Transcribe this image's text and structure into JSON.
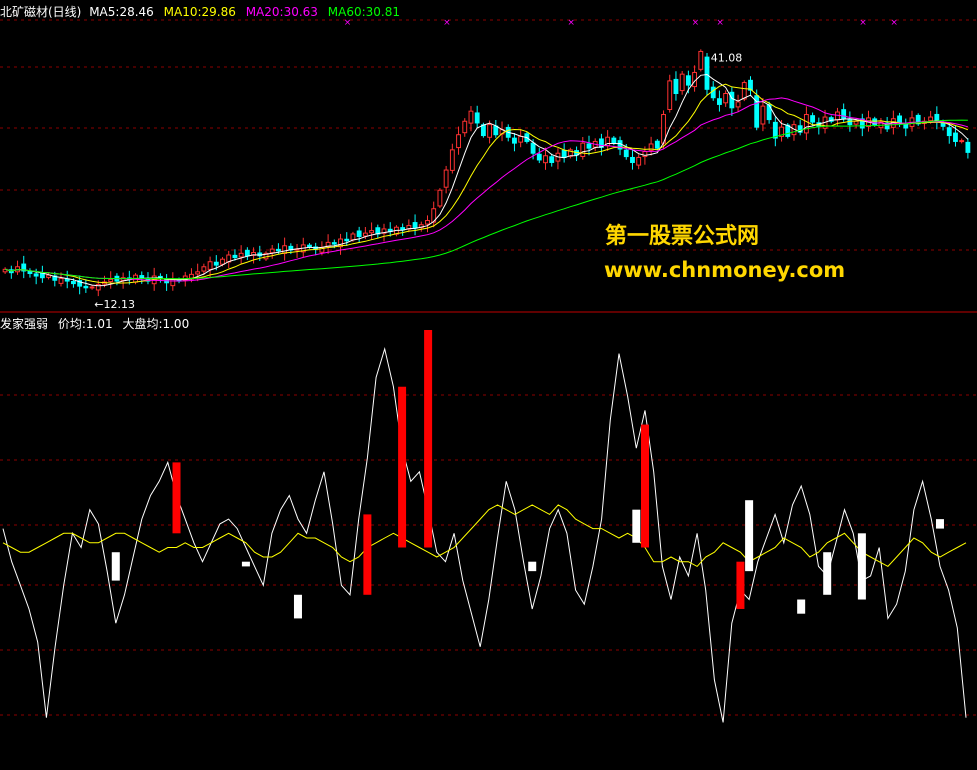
{
  "upper": {
    "stock_name": "北矿磁材(日线)",
    "legend": [
      {
        "label": "MA5:28.46",
        "color": "#ffffff"
      },
      {
        "label": "MA10:29.86",
        "color": "#ffff00"
      },
      {
        "label": "MA20:30.63",
        "color": "#ff00ff"
      },
      {
        "label": "MA60:30.81",
        "color": "#00ff00"
      }
    ],
    "high_label": "41.08",
    "low_label": "←12.13"
  },
  "lower": {
    "indicator_name": "发家强弱",
    "legend": [
      {
        "label": "价均:1.01",
        "color": "#ffffff"
      },
      {
        "label": "大盘均:1.00",
        "color": "#ffffff"
      }
    ]
  },
  "watermark": {
    "line1": "第一股票公式网",
    "line2": "www.chnmoney.com"
  },
  "colors": {
    "up": "#ff3232",
    "down": "#00ffff",
    "ma5": "#ffffff",
    "ma10": "#ffff00",
    "ma20": "#ff00ff",
    "ma60": "#00ff00",
    "grid": "#8b0000",
    "watermark": "#ffd700"
  },
  "chart_data": [
    {
      "type": "candlestick",
      "ylim": [
        10,
        44
      ],
      "close": [
        14.6,
        14.2,
        14.9,
        14.4,
        14.1,
        13.8,
        13.6,
        13.9,
        13.3,
        13.5,
        13.2,
        12.9,
        12.6,
        12.4,
        12.5,
        12.8,
        13.1,
        13.4,
        13.2,
        13.6,
        13.4,
        13.9,
        13.6,
        13.2,
        13.8,
        13.5,
        13.0,
        13.4,
        13.2,
        13.8,
        14.0,
        14.3,
        14.9,
        15.5,
        15.1,
        15.8,
        16.3,
        16.0,
        16.5,
        16.2,
        16.6,
        16.2,
        16.5,
        17.0,
        16.8,
        17.4,
        16.9,
        17.0,
        17.5,
        17.3,
        17.0,
        17.2,
        17.8,
        17.6,
        18.2,
        18.0,
        18.8,
        18.5,
        18.9,
        19.2,
        18.8,
        19.4,
        19.1,
        19.6,
        19.3,
        19.8,
        19.5,
        19.9,
        20.4,
        21.8,
        24.0,
        26.4,
        28.8,
        30.6,
        32.2,
        33.4,
        32.0,
        30.5,
        31.8,
        30.6,
        31.2,
        30.3,
        29.6,
        30.4,
        29.8,
        28.4,
        27.6,
        28.1,
        27.3,
        28.4,
        27.9,
        28.8,
        28.2,
        29.6,
        29.0,
        29.8,
        29.1,
        30.3,
        29.6,
        28.9,
        28.0,
        27.3,
        27.9,
        28.6,
        29.5,
        29.0,
        33.0,
        37.0,
        35.5,
        37.8,
        36.5,
        38.0,
        40.5,
        36.0,
        35.0,
        34.2,
        35.5,
        33.8,
        34.5,
        36.8,
        35.9,
        31.5,
        34.0,
        32.4,
        30.2,
        31.5,
        30.4,
        31.8,
        30.9,
        33.0,
        32.1,
        31.6,
        32.7,
        32.2,
        33.3,
        32.5,
        31.8,
        32.2,
        31.4,
        32.6,
        31.8,
        32.1,
        31.3,
        32.5,
        32.0,
        31.4,
        32.6,
        31.9,
        32.2,
        32.7,
        32.1,
        31.6,
        30.5,
        29.8,
        29.9,
        28.5
      ],
      "ma_order": [
        "MA5",
        "MA10",
        "MA20",
        "MA60"
      ]
    },
    {
      "type": "line+bar",
      "ylim": [
        -4.6,
        4.6
      ],
      "series": [
        {
          "name": "价均",
          "values": [
            0.4,
            -0.3,
            -0.8,
            -1.3,
            -2.0,
            -3.6,
            -2.1,
            -0.8,
            0.3,
            0.0,
            0.8,
            0.5,
            -0.5,
            -1.6,
            -1.0,
            -0.2,
            0.6,
            1.1,
            1.4,
            1.8,
            1.1,
            0.6,
            0.1,
            -0.3,
            0.1,
            0.5,
            0.6,
            0.4,
            0.0,
            -0.4,
            -0.8,
            0.3,
            0.8,
            1.1,
            0.6,
            0.3,
            1.0,
            1.6,
            0.5,
            -0.8,
            -1.0,
            0.6,
            1.9,
            3.6,
            4.2,
            3.4,
            2.1,
            1.4,
            1.6,
            0.8,
            -0.1,
            -0.3,
            0.3,
            -0.7,
            -1.4,
            -2.1,
            -1.1,
            0.2,
            1.4,
            0.8,
            -0.3,
            -1.3,
            -0.6,
            0.4,
            0.8,
            0.3,
            -0.9,
            -1.2,
            -0.4,
            0.6,
            2.7,
            4.1,
            3.2,
            2.1,
            2.9,
            1.6,
            -0.4,
            -1.1,
            -0.2,
            -0.6,
            0.3,
            -0.9,
            -2.8,
            -3.7,
            -1.6,
            -0.9,
            -1.1,
            -0.3,
            0.2,
            0.7,
            0.1,
            0.9,
            1.3,
            0.7,
            -0.4,
            -0.6,
            0.1,
            0.8,
            0.3,
            -0.7,
            -0.6,
            0.0,
            -1.5,
            -1.2,
            -0.5,
            0.8,
            1.4,
            0.6,
            -0.4,
            -0.9,
            -1.7,
            -3.6
          ],
          "color": "#ffffff"
        },
        {
          "name": "大盘均",
          "values": [
            0.1,
            0.0,
            -0.1,
            -0.1,
            0.0,
            0.1,
            0.2,
            0.3,
            0.3,
            0.2,
            0.1,
            0.1,
            0.2,
            0.3,
            0.3,
            0.2,
            0.1,
            0.0,
            -0.1,
            0.0,
            0.0,
            0.1,
            0.0,
            0.0,
            0.1,
            0.2,
            0.3,
            0.2,
            0.1,
            -0.1,
            -0.2,
            -0.2,
            -0.1,
            0.1,
            0.3,
            0.2,
            0.2,
            0.1,
            0.0,
            -0.2,
            -0.3,
            -0.2,
            0.0,
            0.1,
            0.2,
            0.3,
            0.2,
            0.1,
            0.0,
            -0.1,
            -0.2,
            -0.1,
            0.0,
            0.2,
            0.4,
            0.6,
            0.8,
            0.9,
            0.8,
            0.7,
            0.8,
            0.9,
            0.8,
            0.7,
            0.9,
            0.8,
            0.6,
            0.5,
            0.4,
            0.4,
            0.3,
            0.2,
            0.3,
            0.2,
            0.0,
            -0.3,
            -0.3,
            -0.2,
            -0.3,
            -0.3,
            -0.4,
            -0.2,
            -0.1,
            0.1,
            0.0,
            -0.1,
            -0.3,
            -0.2,
            -0.1,
            0.0,
            0.2,
            0.1,
            0.0,
            -0.2,
            -0.1,
            0.1,
            0.2,
            0.3,
            0.1,
            -0.1,
            -0.2,
            -0.3,
            -0.4,
            -0.2,
            0.0,
            0.2,
            0.1,
            -0.1,
            -0.2,
            -0.1,
            0.0,
            0.1
          ],
          "color": "#ffff00"
        }
      ],
      "bars": [
        {
          "i": 13,
          "top": -0.1,
          "bottom": -0.7,
          "color": "#ffffff"
        },
        {
          "i": 20,
          "top": 1.8,
          "bottom": 0.3,
          "color": "#ff0000"
        },
        {
          "i": 28,
          "top": -0.3,
          "bottom": -0.4,
          "color": "#ffffff"
        },
        {
          "i": 34,
          "top": -1.0,
          "bottom": -1.5,
          "color": "#ffffff"
        },
        {
          "i": 42,
          "top": 0.7,
          "bottom": -1.0,
          "color": "#ff0000"
        },
        {
          "i": 46,
          "top": 3.4,
          "bottom": 0.0,
          "color": "#ff0000"
        },
        {
          "i": 49,
          "top": 4.6,
          "bottom": 0.0,
          "color": "#ff0000"
        },
        {
          "i": 61,
          "top": -0.3,
          "bottom": -0.5,
          "color": "#ffffff"
        },
        {
          "i": 73,
          "top": 0.8,
          "bottom": 0.1,
          "color": "#ffffff"
        },
        {
          "i": 74,
          "top": 2.6,
          "bottom": 0.0,
          "color": "#ff0000"
        },
        {
          "i": 85,
          "top": -0.3,
          "bottom": -1.3,
          "color": "#ff0000"
        },
        {
          "i": 86,
          "top": 1.0,
          "bottom": -0.5,
          "color": "#ffffff"
        },
        {
          "i": 92,
          "top": -1.1,
          "bottom": -1.4,
          "color": "#ffffff"
        },
        {
          "i": 95,
          "top": -0.1,
          "bottom": -1.0,
          "color": "#ffffff"
        },
        {
          "i": 99,
          "top": 0.3,
          "bottom": -1.1,
          "color": "#ffffff"
        },
        {
          "i": 108,
          "top": 0.6,
          "bottom": 0.4,
          "color": "#ffffff"
        },
        {
          "i": 113,
          "top": 1.0,
          "bottom": -0.2,
          "color": "#ffffff"
        },
        {
          "i": 120,
          "top": 0.7,
          "bottom": -0.1,
          "color": "#ffffff"
        }
      ]
    }
  ]
}
